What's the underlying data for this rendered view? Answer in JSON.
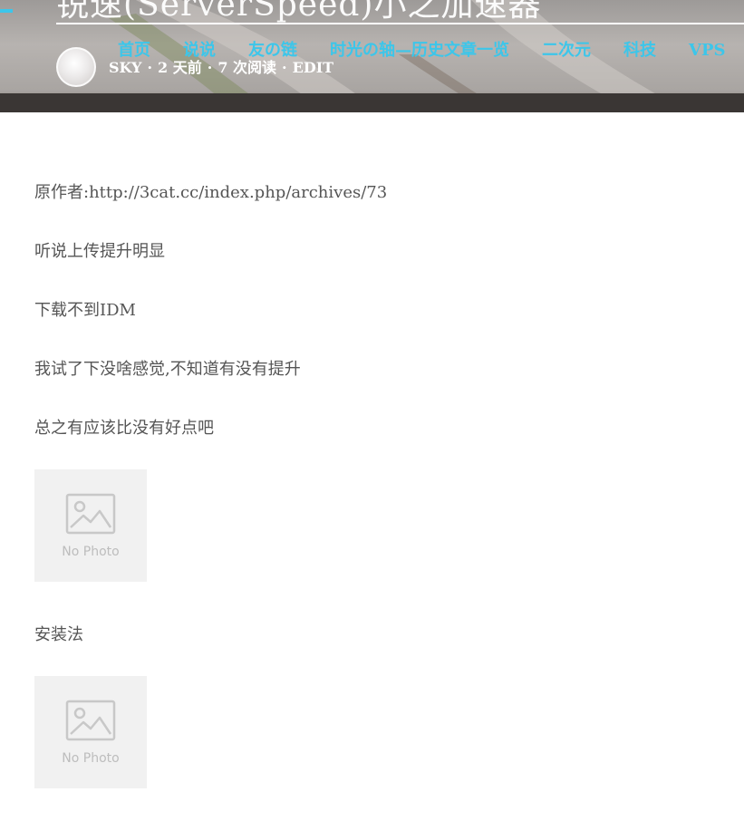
{
  "post": {
    "title": "锐速(ServerSpeed)小之加速器",
    "author": "SKY",
    "posted": "2 天前",
    "reads": "7 次阅读",
    "edit_label": "EDIT",
    "separator": "·"
  },
  "nav": {
    "items": [
      {
        "label": "首页"
      },
      {
        "label": "说说"
      },
      {
        "label": "友の链"
      },
      {
        "label": "时光の轴—历史文章一览"
      },
      {
        "label": "二次元"
      },
      {
        "label": "科技"
      },
      {
        "label": "VPS"
      }
    ]
  },
  "content": {
    "paragraphs": [
      "原作者:http://3cat.cc/index.php/archives/73",
      "听说上传提升明显",
      "下载不到IDM",
      "我试了下没啥感觉,不知道有没有提升",
      "总之有应该比没有好点吧",
      "安装法"
    ],
    "placeholder_label": "No Photo"
  },
  "colors": {
    "accent": "#3cc6ea",
    "text": "#555555",
    "placeholder_bg": "#f1f1f1"
  },
  "icons": {
    "photo_placeholder": "image-placeholder-icon"
  }
}
